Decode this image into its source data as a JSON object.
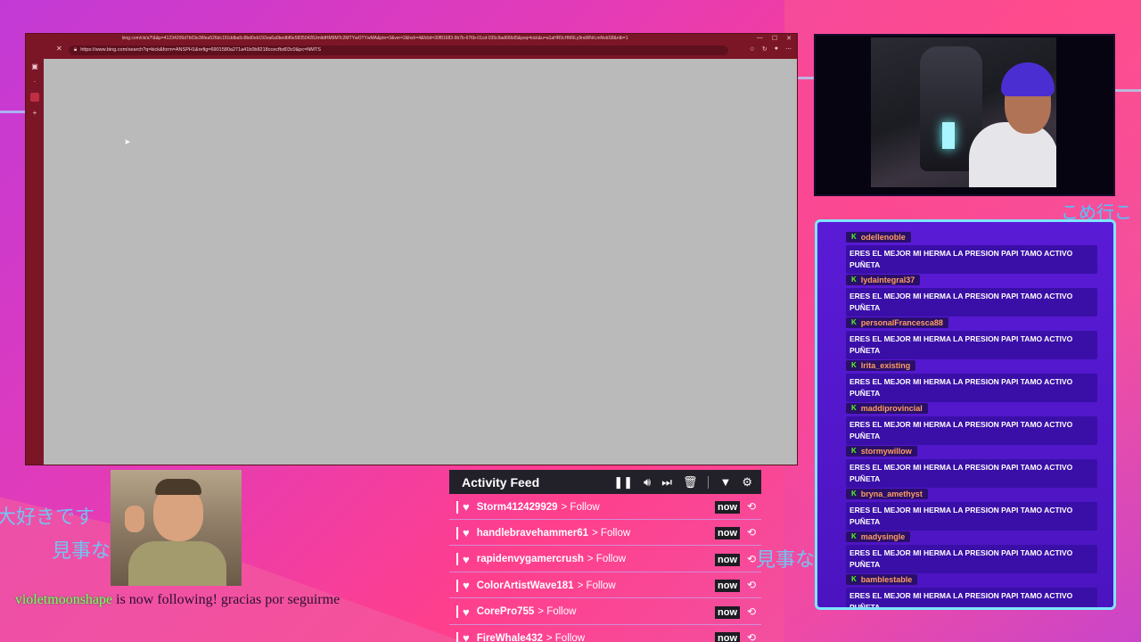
{
  "background": {
    "jp_left_1": "大好きです",
    "jp_left_2": "見事な",
    "jp_right_1": "見事な",
    "jp_top_right": "こめ行こ"
  },
  "browser": {
    "tab_url": "bing.com/ck/a?!&&p=41234206d7b03e36fea526dc191ddba5c8bd0eb192ea6a0bedbf6e58350428JmltdHM9MTc2MTYwOTYwMA&ptn=3&ver=2&hsh=4&fclid=30f81683-9b7b-676b-01cd-035c9ad666d5&psq=kick&u=a1aHR0cHM6Ly9raWNrLmNvbS8&ntb=1",
    "address_url": "https://www.bing.com/search?q=kick&form=ANSPH1&refig=6901580a271a41b0b8218ccecfbd03c0&pc=NMTS"
  },
  "chat": {
    "messages": [
      {
        "user": "odellenoble",
        "text": "ERES EL MEJOR MI HERMA LA PRESION PAPI TAMO ACTIVO PUÑETA"
      },
      {
        "user": "lydaintegral37",
        "text": "ERES EL MEJOR MI HERMA LA PRESION PAPI TAMO ACTIVO PUÑETA"
      },
      {
        "user": "personalFrancesca88",
        "text": "ERES EL MEJOR MI HERMA LA PRESION PAPI TAMO ACTIVO PUÑETA"
      },
      {
        "user": "lrita_existing",
        "text": "ERES EL MEJOR MI HERMA LA PRESION PAPI TAMO ACTIVO PUÑETA"
      },
      {
        "user": "maddiprovincial",
        "text": "ERES EL MEJOR MI HERMA LA PRESION PAPI TAMO ACTIVO PUÑETA"
      },
      {
        "user": "stormywillow",
        "text": "ERES EL MEJOR MI HERMA LA PRESION PAPI TAMO ACTIVO PUÑETA"
      },
      {
        "user": "bryna_amethyst",
        "text": "ERES EL MEJOR MI HERMA LA PRESION PAPI TAMO ACTIVO PUÑETA"
      },
      {
        "user": "madysingle",
        "text": "ERES EL MEJOR MI HERMA LA PRESION PAPI TAMO ACTIVO PUÑETA"
      },
      {
        "user": "bamblestable",
        "text": "ERES EL MEJOR MI HERMA LA PRESION PAPI TAMO ACTIVO PUÑETA"
      }
    ]
  },
  "follow_alert": {
    "username": "violetmoonshape",
    "message": " is now following! gracias por seguirme"
  },
  "activity_feed": {
    "title": "Activity Feed",
    "items": [
      {
        "name": "Storm412429929",
        "action": "> Follow",
        "time": "now"
      },
      {
        "name": "handlebravehammer61",
        "action": "> Follow",
        "time": "now"
      },
      {
        "name": "rapidenvygamercrush",
        "action": "> Follow",
        "time": "now"
      },
      {
        "name": "ColorArtistWave181",
        "action": "> Follow",
        "time": "now"
      },
      {
        "name": "CorePro755",
        "action": "> Follow",
        "time": "now"
      },
      {
        "name": "FireWhale432",
        "action": "> Follow",
        "time": "now"
      }
    ]
  }
}
